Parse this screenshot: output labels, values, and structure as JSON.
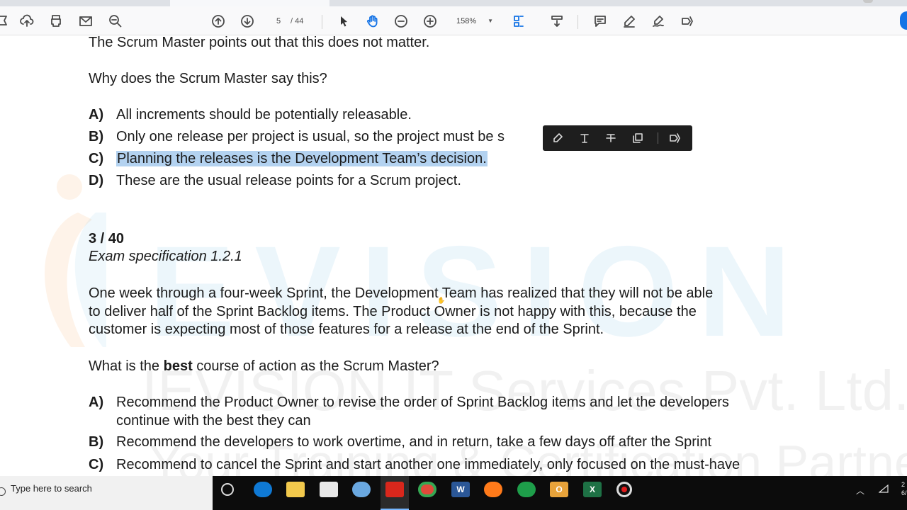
{
  "viewer": {
    "current_page": "5",
    "total_pages": "/ 44",
    "zoom": "158%"
  },
  "document": {
    "line_intro": "The Scrum Master points out that this does not matter.",
    "q2_question": "Why does the Scrum Master say this?",
    "q2_options": [
      {
        "letter": "A)",
        "text": "All increments should be potentially releasable."
      },
      {
        "letter": "B)",
        "text": "Only one release per project is usual, so the project must be s"
      },
      {
        "letter": "C)",
        "text": "Planning the releases is the Development Team’s decision."
      },
      {
        "letter": "D)",
        "text": "These are the usual release points for a Scrum project."
      }
    ],
    "q3_number": "3 / 40",
    "q3_spec": "Exam specification 1.2.1",
    "q3_body": [
      "One week through a four-week Sprint, the Development Team has realized that they will not be able",
      "to deliver half of the Sprint Backlog items. The Product Owner is not happy with this, because the",
      "customer is expecting most of those features for a release at the end of the Sprint."
    ],
    "q3_question_pre": "What is the ",
    "q3_question_bold": "best",
    "q3_question_post": " course of action as the Scrum Master?",
    "q3_options": [
      {
        "letter": "A)",
        "line1": "Recommend the Product Owner to revise the order of Sprint Backlog items and let the developers",
        "line2": "continue with the best they can"
      },
      {
        "letter": "B)",
        "line1": "Recommend the developers to work overtime, and in return, take a few days off after the Sprint"
      },
      {
        "letter": "C)",
        "line1": "Recommend to cancel the Sprint and start another one immediately, only focused on the must-have"
      }
    ],
    "watermark": {
      "big": "EVISION",
      "line1": "IEVISION IT Services Pvt. Ltd.",
      "line2": "Your Training & Certification Partner"
    }
  },
  "taskbar": {
    "search_placeholder": "Type here to search",
    "clock": "2\n6/"
  },
  "colors": {
    "highlight": "#b3d2f0",
    "accent": "#1473e6",
    "watermark_blue": "#3aa0d8"
  }
}
